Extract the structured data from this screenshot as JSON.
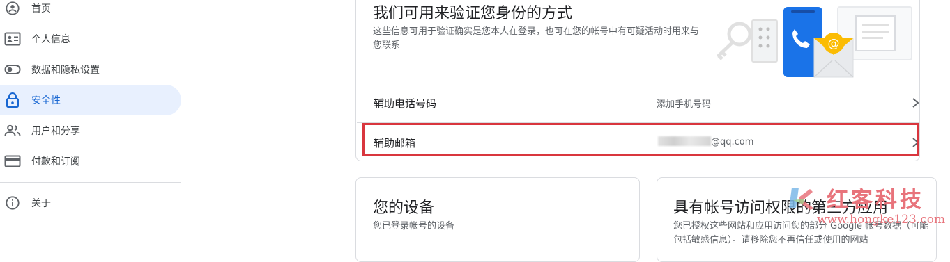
{
  "sidebar": {
    "items": [
      {
        "label": "首页",
        "icon": "account-circle-icon"
      },
      {
        "label": "个人信息",
        "icon": "id-card-icon"
      },
      {
        "label": "数据和隐私设置",
        "icon": "toggle-icon"
      },
      {
        "label": "安全性",
        "icon": "lock-icon",
        "active": true
      },
      {
        "label": "用户和分享",
        "icon": "people-icon"
      },
      {
        "label": "付款和订阅",
        "icon": "credit-card-icon"
      },
      {
        "label": "关于",
        "icon": "info-icon"
      }
    ]
  },
  "verify_card": {
    "title": "我们可用来验证您身份的方式",
    "description": "这些信息可用于验证确实是您本人在登录，也可在您的帐号中有可疑活动时用来与您联系",
    "rows": [
      {
        "label": "辅助电话号码",
        "value": "添加手机号码"
      },
      {
        "label": "辅助邮箱",
        "value_suffix": "@qq.com"
      }
    ]
  },
  "devices_card": {
    "title": "您的设备",
    "description": "您已登录帐号的设备"
  },
  "third_party_card": {
    "title": "具有帐号访问权限的第三方应用",
    "description": "您已授权这些网站和应用访问您的部分 Google 帐号数据（可能包括敏感信息）。请移除您不再信任或使用的网站"
  },
  "watermark": {
    "brand": "红客科技",
    "url": "www.hongke123.com"
  },
  "colors": {
    "accent": "#1967d2",
    "active_bg": "#e8f0fe",
    "highlight_border": "#d9363e",
    "watermark": "#e8737b"
  }
}
